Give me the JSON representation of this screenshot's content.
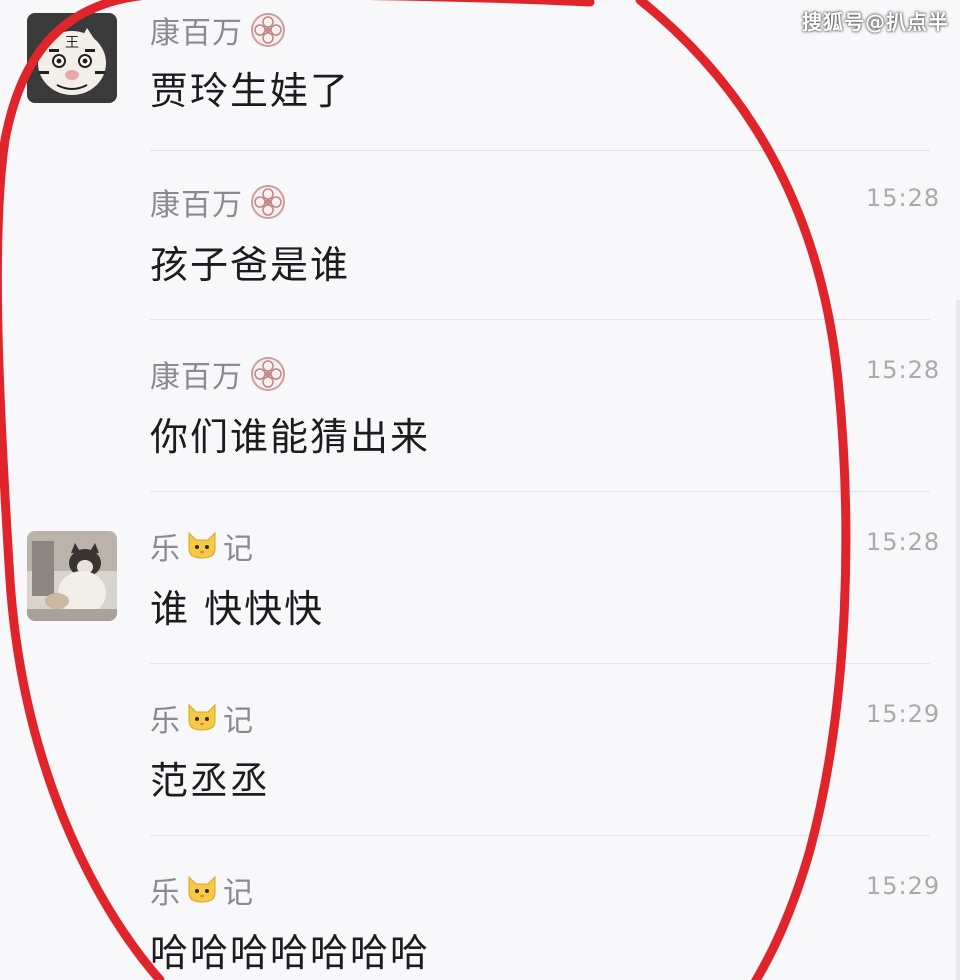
{
  "watermark": "搜狐号@扒点半",
  "messages": [
    {
      "sender": "康百万",
      "text": "贾玲生娃了",
      "time": "",
      "avatar": "tiger-avatar"
    },
    {
      "sender": "康百万",
      "text": "孩子爸是谁",
      "time": "15:28",
      "avatar": ""
    },
    {
      "sender": "康百万",
      "text": "你们谁能猜出来",
      "time": "15:28",
      "avatar": ""
    },
    {
      "sender_prefix": "乐",
      "sender_suffix": "记",
      "text": "谁 快快快",
      "time": "15:28",
      "avatar": "cat-photo-avatar"
    },
    {
      "sender_prefix": "乐",
      "sender_suffix": "记",
      "text": "范丞丞",
      "time": "15:29",
      "avatar": ""
    },
    {
      "sender_prefix": "乐",
      "sender_suffix": "记",
      "text": "哈哈哈哈哈哈哈",
      "time": "15:29",
      "avatar": ""
    }
  ],
  "icons": {
    "badge": "flower-badge-icon",
    "cat": "cat-face-icon"
  },
  "colors": {
    "annotation": "#e0242b",
    "name": "#8a8a90",
    "text": "#1c1c1e",
    "time": "#a9a9ae"
  }
}
